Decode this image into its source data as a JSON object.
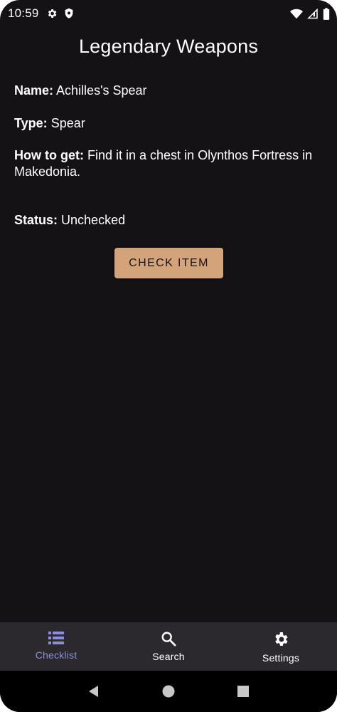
{
  "status_bar": {
    "time": "10:59",
    "icons": [
      "gear-icon",
      "shield-icon",
      "wifi-icon",
      "cell-signal-icon",
      "battery-icon"
    ]
  },
  "header": {
    "title": "Legendary Weapons"
  },
  "item": {
    "name_label": "Name:",
    "name_value": "Achilles's Spear",
    "type_label": "Type:",
    "type_value": "Spear",
    "how_label": "How to get:",
    "how_value": "Find it in a chest in Olynthos Fortress in Makedonia.",
    "status_label": "Status:",
    "status_value": "Unchecked"
  },
  "actions": {
    "check_label": "CHECK ITEM"
  },
  "bottom_nav": {
    "items": [
      {
        "label": "Checklist",
        "icon": "list-icon",
        "active": true
      },
      {
        "label": "Search",
        "icon": "search-icon",
        "active": false
      },
      {
        "label": "Settings",
        "icon": "gear-icon",
        "active": false
      }
    ]
  },
  "colors": {
    "background": "#141215",
    "button": "#d3a47a",
    "nav_background": "#2b292d",
    "nav_active": "#8e8fd9"
  }
}
